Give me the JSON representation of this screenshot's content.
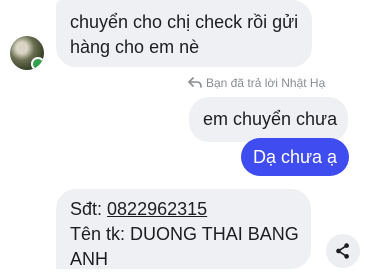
{
  "messages": {
    "incoming_1": {
      "line1": "chuyển cho chị check rồi gửi",
      "line2": "hàng cho em nè"
    },
    "reply_hint": "Bạn đã trả lời Nhật Hạ",
    "outgoing_quoted": "em chuyển chưa",
    "outgoing_1": "Dạ chưa ạ",
    "incoming_2": {
      "sdt_label": "Sđt: ",
      "sdt_value": "0822962315",
      "account_line": "Tên tk: DUONG THAI BANG",
      "account_line2": "ANH"
    }
  },
  "icons": {
    "reply": "reply-arrow-icon",
    "share": "share-icon",
    "presence": "online-dot-icon"
  },
  "colors": {
    "outgoing_bubble": "#3f4cf0",
    "incoming_bubble": "#eef0f3",
    "online": "#31a24c"
  }
}
